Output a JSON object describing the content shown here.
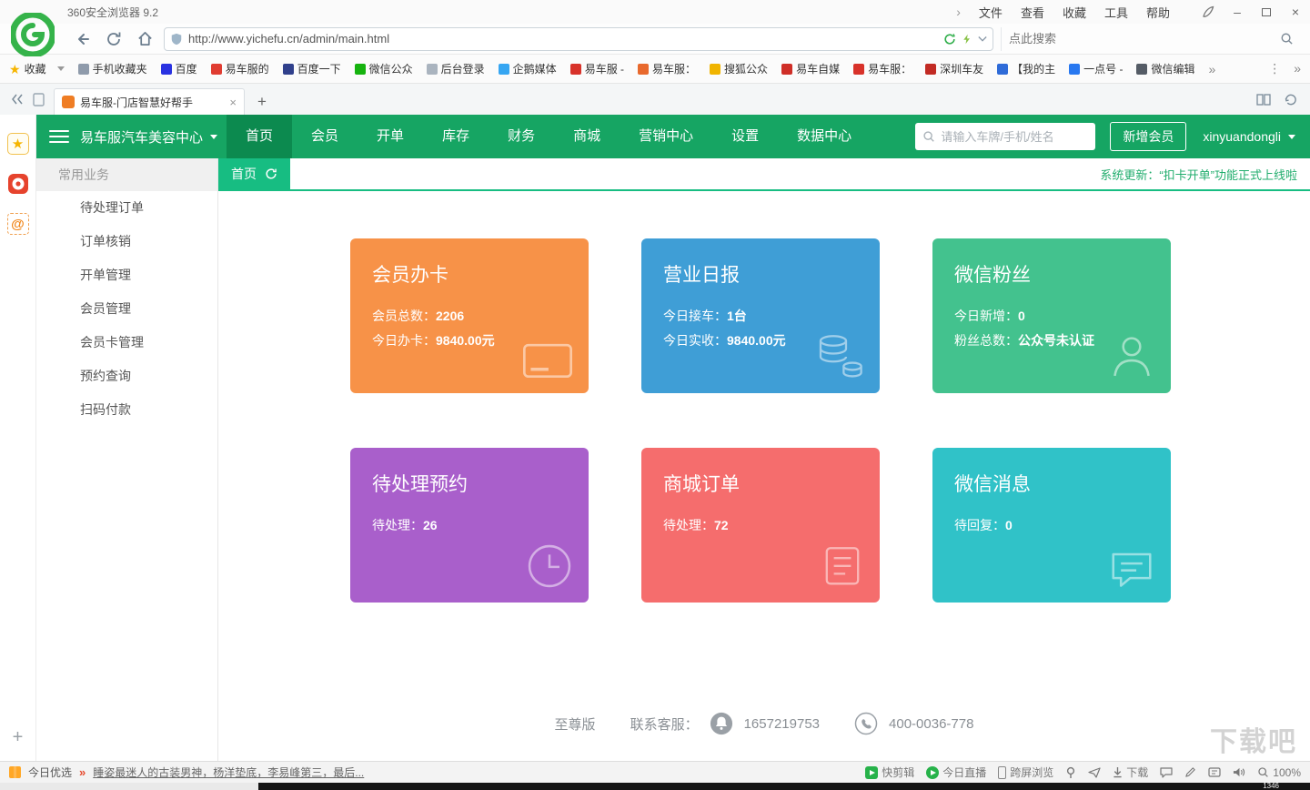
{
  "browser": {
    "window_title": "360安全浏览器 9.2",
    "menu_expand": "›",
    "menu_items": [
      "文件",
      "查看",
      "收藏",
      "工具",
      "帮助"
    ],
    "nav": {
      "url": "http://www.yichefu.cn/admin/main.html",
      "search_placeholder": "点此搜索"
    },
    "bookmarks_bar": {
      "items": [
        {
          "label": "收藏",
          "color": "#f6b500"
        },
        {
          "label": "手机收藏夹",
          "color": "#8f9bab"
        },
        {
          "label": "百度",
          "color": "#2932e1"
        },
        {
          "label": "易车服的",
          "color": "#e03c31"
        },
        {
          "label": "百度一下",
          "color": "#30408c"
        },
        {
          "label": "微信公众",
          "color": "#16b30f"
        },
        {
          "label": "后台登录",
          "color": "#aab4bf"
        },
        {
          "label": "企鹅媒体",
          "color": "#36a6f2"
        },
        {
          "label": "易车服 -",
          "color": "#d8322a"
        },
        {
          "label": "易车服：",
          "color": "#e8692d"
        },
        {
          "label": "搜狐公众",
          "color": "#f0b400"
        },
        {
          "label": "易车自媒",
          "color": "#cf2e27"
        },
        {
          "label": "易车服：",
          "color": "#d8322a"
        },
        {
          "label": "深圳车友",
          "color": "#c22b24"
        },
        {
          "label": "【我的主",
          "color": "#2f6bd8"
        },
        {
          "label": "一点号 -",
          "color": "#2878f0"
        },
        {
          "label": "微信编辑",
          "color": "#555c66"
        }
      ],
      "overflow": "»"
    },
    "tab": {
      "title": "易车服-门店智慧好帮手"
    },
    "statusbar": {
      "promo_label": "今日优选",
      "ticker": "睡姿最迷人的古装男神，杨洋垫底，李易峰第三，最后...",
      "tool_quickcut": "快剪辑",
      "tool_live": "今日直播",
      "tool_crossscreen": "跨屏浏览",
      "tool_download": "下载",
      "zoom": "100%"
    },
    "taskbar_time": "1346"
  },
  "app": {
    "header": {
      "brand": "易车服汽车美容中心",
      "nav_items": [
        "首页",
        "会员",
        "开单",
        "库存",
        "财务",
        "商城",
        "营销中心",
        "设置",
        "数据中心"
      ],
      "search_placeholder": "请输入车牌/手机/姓名",
      "add_member_button": "新增会员",
      "username": "xinyuandongli"
    },
    "breadcrumb": {
      "current": "首页"
    },
    "notice": "系统更新：“扣卡开单”功能正式上线啦",
    "sidebar": {
      "title": "常用业务",
      "items": [
        "待处理订单",
        "订单核销",
        "开单管理",
        "会员管理",
        "会员卡管理",
        "预约查询",
        "扫码付款"
      ]
    },
    "cards": [
      {
        "title": "会员办卡",
        "color": "#f79248",
        "icon": "credit-card",
        "lines": [
          {
            "label": "会员总数：",
            "value": "2206"
          },
          {
            "label": "今日办卡：",
            "value": "9840.00元"
          }
        ]
      },
      {
        "title": "营业日报",
        "color": "#3f9ed6",
        "icon": "coins",
        "lines": [
          {
            "label": "今日接车：",
            "value": "1台"
          },
          {
            "label": "今日实收：",
            "value": "9840.00元"
          }
        ]
      },
      {
        "title": "微信粉丝",
        "color": "#43c28e",
        "icon": "person",
        "lines": [
          {
            "label": "今日新增：",
            "value": "0"
          },
          {
            "label": "粉丝总数：",
            "value": "公众号未认证"
          }
        ]
      },
      {
        "title": "待处理预约",
        "color": "#a95fcb",
        "icon": "clock",
        "lines": [
          {
            "label": "待处理：",
            "value": "26"
          }
        ]
      },
      {
        "title": "商城订单",
        "color": "#f56d6d",
        "icon": "order-list",
        "lines": [
          {
            "label": "待处理：",
            "value": "72"
          }
        ]
      },
      {
        "title": "微信消息",
        "color": "#30c2c8",
        "icon": "chat-bubble",
        "lines": [
          {
            "label": "待回复：",
            "value": "0"
          }
        ]
      }
    ],
    "footer": {
      "edition": "至尊版",
      "service_label": "联系客服：",
      "qq_number": "1657219753",
      "phone_number": "400-0036-778"
    },
    "watermark": "下载吧"
  }
}
